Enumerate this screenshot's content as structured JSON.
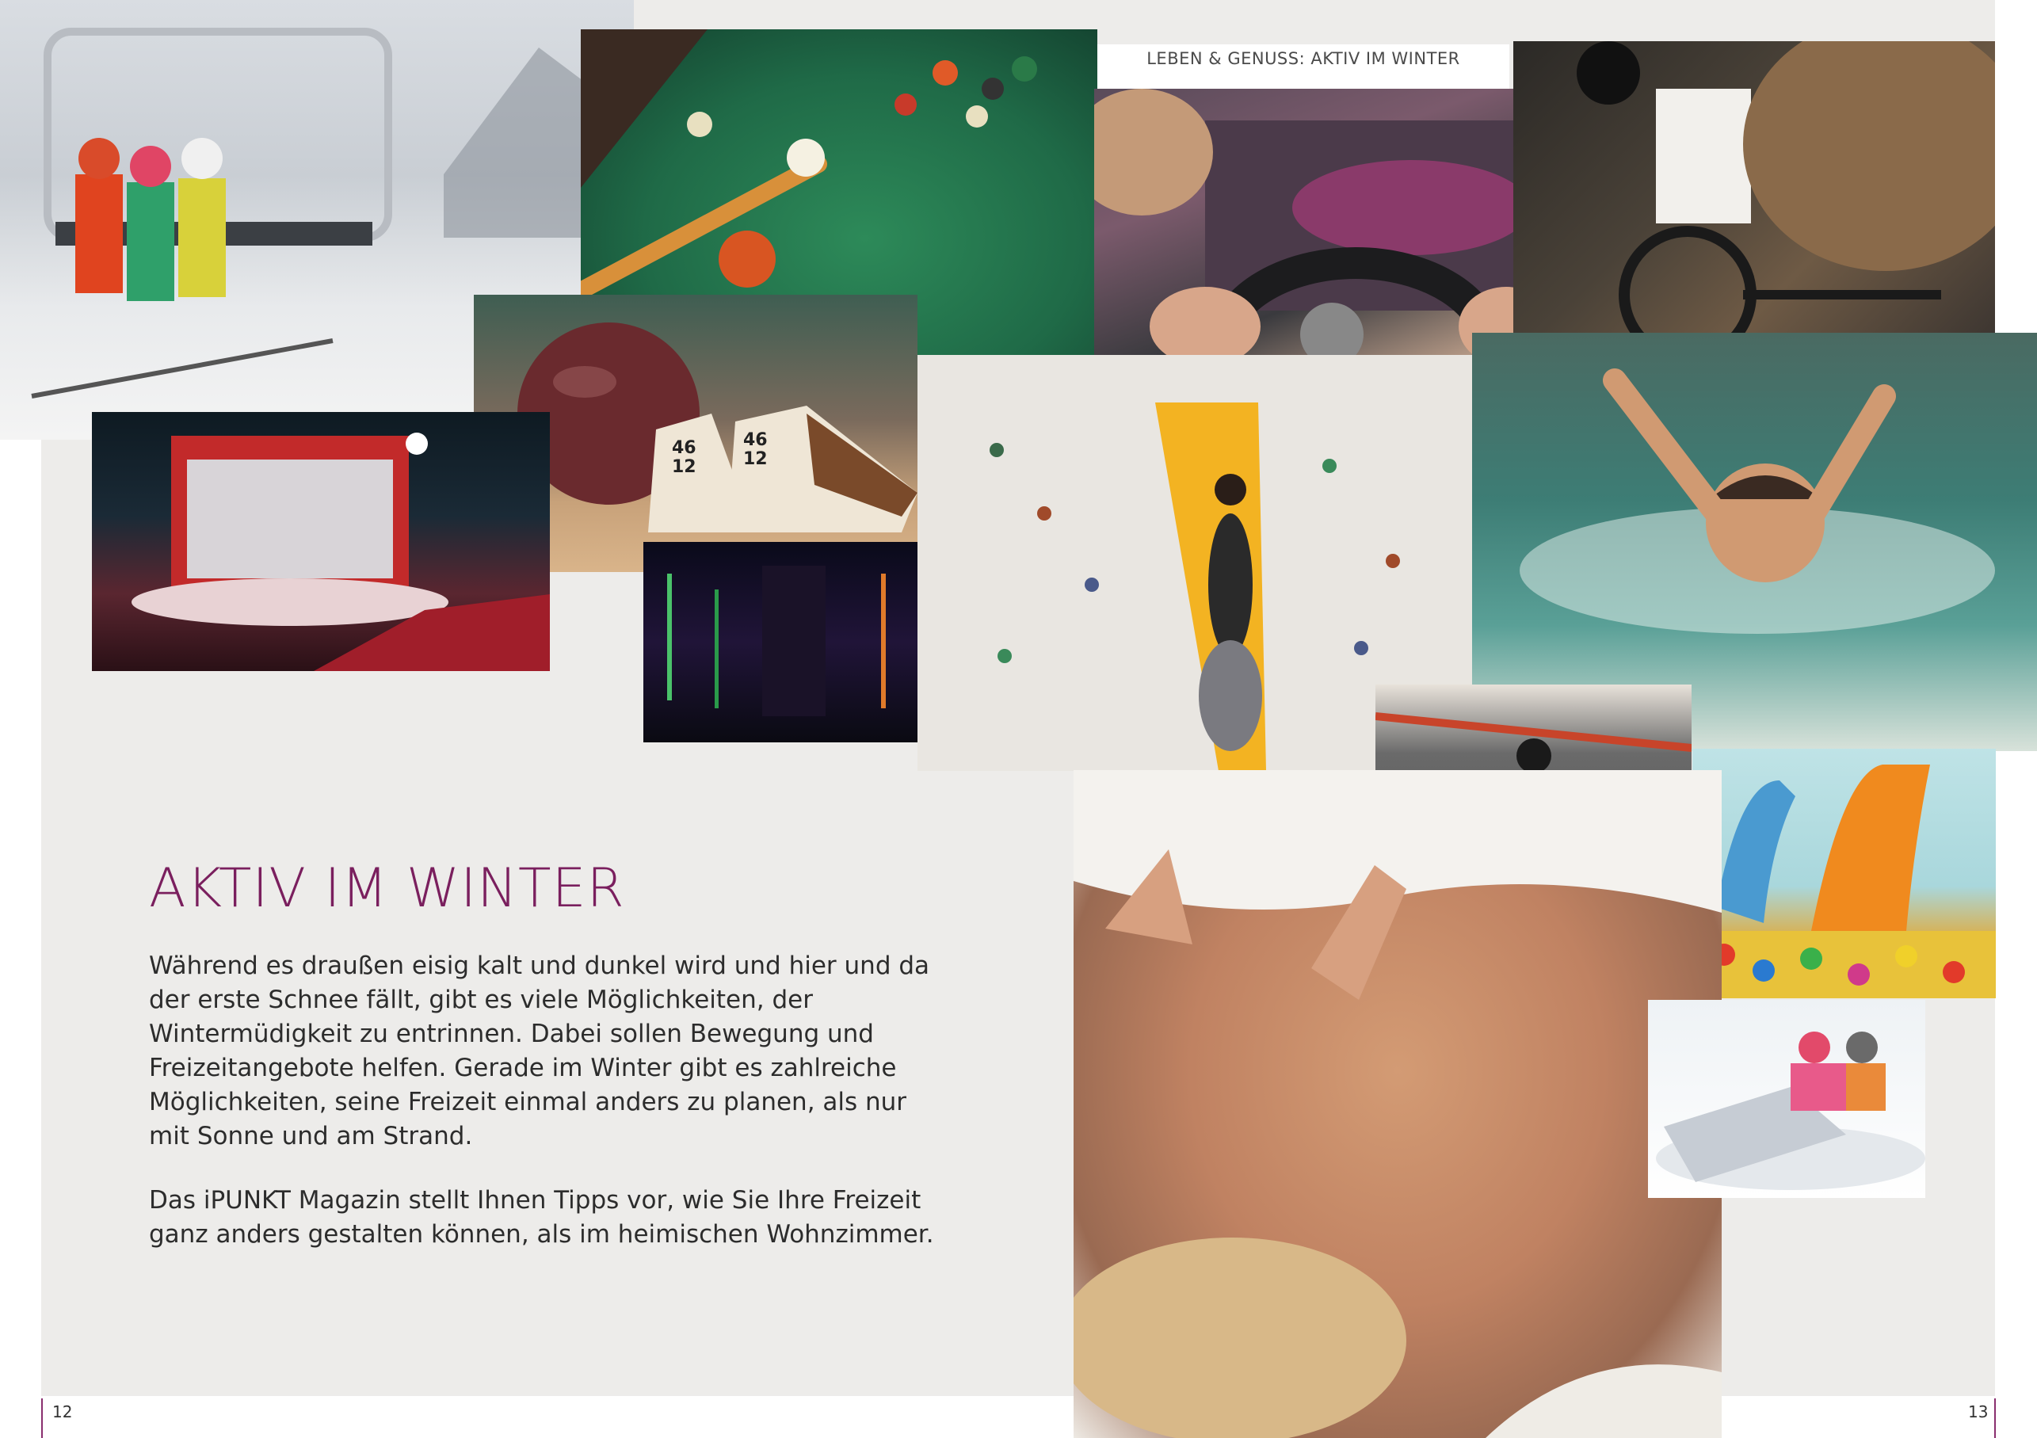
{
  "header": {
    "running_title": "LEBEN & GENUSS: AKTIV IM WINTER"
  },
  "article": {
    "title": "AKTIV IM WINTER",
    "paragraph_1": "Während es draußen eisig kalt und dunkel wird und hier und da der erste Schnee fällt, gibt es viele Möglichkeiten, der Wintermüdigkeit zu entrinnen. Dabei sollen Bewegung und Freizeitangebote helfen. Gerade im Winter gibt es zahlreiche Möglichkeiten, seine Freizeit einmal anders zu planen, als nur mit Sonne und am Strand.",
    "paragraph_2": "Das iPUNKT Magazin stellt Ihnen Tipps vor, wie Sie Ihre Freizeit ganz anders gestalten können, als im heimischen Wohnzimmer."
  },
  "footer": {
    "page_left": "12",
    "page_right": "13"
  },
  "colors": {
    "title": "#7a1f5e",
    "accent_rule": "#8a2f6f",
    "panel": "#edecea"
  },
  "photos": {
    "bowling_shoe_numbers": "46 12"
  }
}
